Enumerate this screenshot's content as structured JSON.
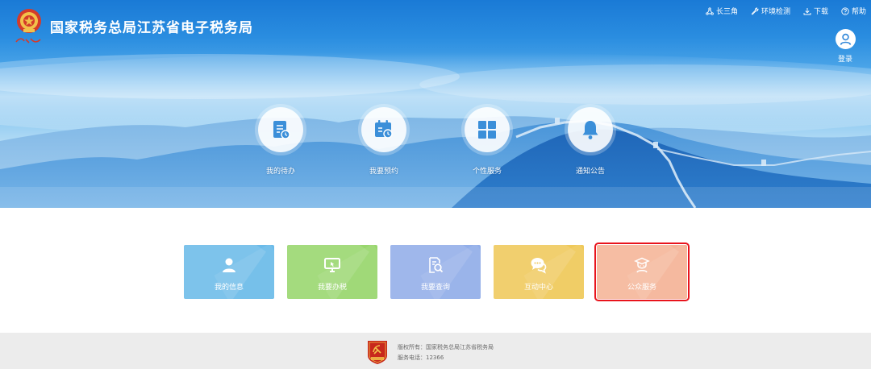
{
  "header": {
    "title": "国家税务总局江苏省电子税务局",
    "nav": [
      {
        "label": "长三角",
        "icon": "triangle-nodes-icon"
      },
      {
        "label": "环境检测",
        "icon": "wrench-icon"
      },
      {
        "label": "下载",
        "icon": "download-icon"
      },
      {
        "label": "帮助",
        "icon": "help-circle-icon"
      }
    ],
    "login_label": "登录"
  },
  "quick_links": [
    {
      "label": "我的待办",
      "icon": "todo-document-icon"
    },
    {
      "label": "我要预约",
      "icon": "calendar-clock-icon"
    },
    {
      "label": "个性服务",
      "icon": "grid-icon"
    },
    {
      "label": "通知公告",
      "icon": "bell-icon"
    }
  ],
  "cards": [
    {
      "label": "我的信息",
      "icon": "user-icon",
      "color": "#6bbbe9"
    },
    {
      "label": "我要办税",
      "icon": "monitor-icon",
      "color": "#98d66d"
    },
    {
      "label": "我要查询",
      "icon": "document-search-icon",
      "color": "#92aee9"
    },
    {
      "label": "互动中心",
      "icon": "chat-bubbles-icon",
      "color": "#efc95a"
    },
    {
      "label": "公众服务",
      "icon": "scholar-icon",
      "color": "#f5b497",
      "selected": true
    }
  ],
  "footer": {
    "copyright": "版权所有：国家税务总局江苏省税务局",
    "phone": "服务电话：12366"
  },
  "colors": {
    "header_blue": "#1a7ad6",
    "quick_icon": "#3b8fd9",
    "selection_outline": "#e8141c",
    "footer_bg": "#ececec"
  }
}
